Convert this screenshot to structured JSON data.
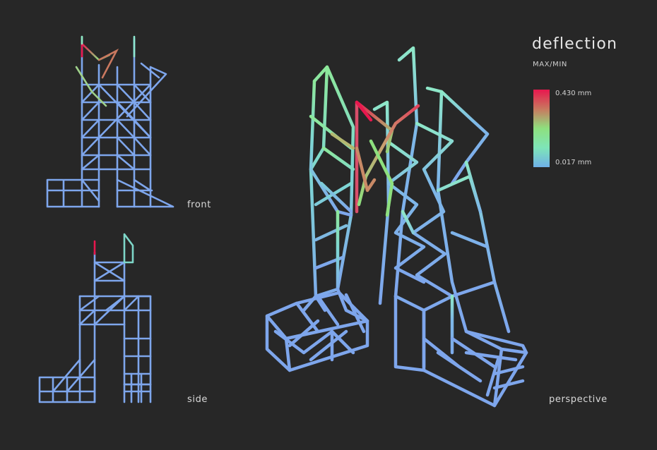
{
  "legend": {
    "title": "deflection",
    "subtitle": "MAX/MIN",
    "max_label": "0.430 mm",
    "min_label": "0.017 mm",
    "max_value": 0.43,
    "min_value": 0.017,
    "colors": [
      "#e8174e",
      "#c9785f",
      "#8ee07e",
      "#7ee5b8",
      "#6fb0e8"
    ]
  },
  "views": {
    "front": "front",
    "side": "side",
    "perspective": "perspective"
  },
  "palette": {
    "background": "#272727",
    "base_member": "#7ea6ec",
    "mid_member": "#7ed6d4",
    "high_member": "#8de89a",
    "max_member": "#e8174e"
  }
}
